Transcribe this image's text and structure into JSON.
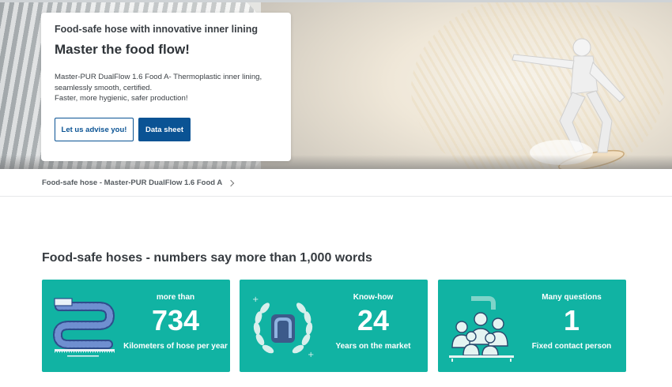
{
  "hero": {
    "eyebrow": "Food-safe hose with innovative inner lining",
    "title": "Master the food flow!",
    "description_line1": "Master-PUR DualFlow 1.6 Food A- Thermoplastic inner lining,",
    "description_line2": "seamlessly smooth, certified.",
    "description_line3": "Faster, more hygienic, safer production!",
    "buttons": {
      "advise": "Let us advise you!",
      "datasheet": "Data sheet"
    }
  },
  "breadcrumb": {
    "item": "Food-safe hose - Master-PUR DualFlow 1.6 Food A",
    "separator_icon": "chevron-right-icon"
  },
  "section": {
    "title": "Food-safe hoses - numbers say more than 1,000 words",
    "stats": [
      {
        "top": "more than",
        "number": "734",
        "bottom": "Kilometers of hose per year",
        "icon": "hose-coil-icon"
      },
      {
        "top": "Know-how",
        "number": "24",
        "bottom": "Years on the market",
        "icon": "laurel-wreath-icon"
      },
      {
        "top": "Many questions",
        "number": "1",
        "bottom": "Fixed contact person",
        "icon": "people-group-icon"
      }
    ]
  },
  "colors": {
    "brand_blue": "#0a5394",
    "teal": "#11b3a3",
    "text_dark": "#363b40"
  }
}
